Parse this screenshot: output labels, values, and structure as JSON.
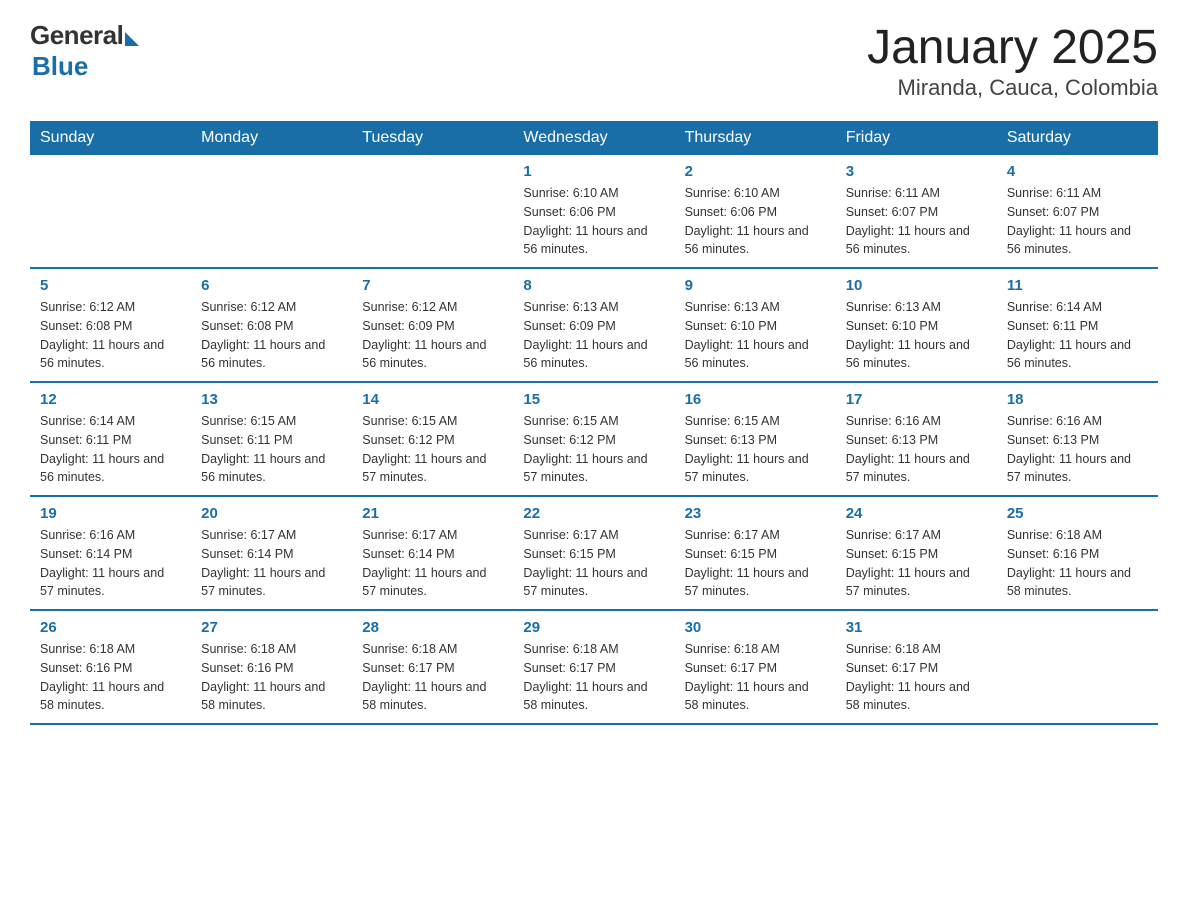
{
  "logo": {
    "general": "General",
    "blue": "Blue"
  },
  "title": "January 2025",
  "subtitle": "Miranda, Cauca, Colombia",
  "weekdays": [
    "Sunday",
    "Monday",
    "Tuesday",
    "Wednesday",
    "Thursday",
    "Friday",
    "Saturday"
  ],
  "weeks": [
    [
      {
        "day": "",
        "info": ""
      },
      {
        "day": "",
        "info": ""
      },
      {
        "day": "",
        "info": ""
      },
      {
        "day": "1",
        "info": "Sunrise: 6:10 AM\nSunset: 6:06 PM\nDaylight: 11 hours and 56 minutes."
      },
      {
        "day": "2",
        "info": "Sunrise: 6:10 AM\nSunset: 6:06 PM\nDaylight: 11 hours and 56 minutes."
      },
      {
        "day": "3",
        "info": "Sunrise: 6:11 AM\nSunset: 6:07 PM\nDaylight: 11 hours and 56 minutes."
      },
      {
        "day": "4",
        "info": "Sunrise: 6:11 AM\nSunset: 6:07 PM\nDaylight: 11 hours and 56 minutes."
      }
    ],
    [
      {
        "day": "5",
        "info": "Sunrise: 6:12 AM\nSunset: 6:08 PM\nDaylight: 11 hours and 56 minutes."
      },
      {
        "day": "6",
        "info": "Sunrise: 6:12 AM\nSunset: 6:08 PM\nDaylight: 11 hours and 56 minutes."
      },
      {
        "day": "7",
        "info": "Sunrise: 6:12 AM\nSunset: 6:09 PM\nDaylight: 11 hours and 56 minutes."
      },
      {
        "day": "8",
        "info": "Sunrise: 6:13 AM\nSunset: 6:09 PM\nDaylight: 11 hours and 56 minutes."
      },
      {
        "day": "9",
        "info": "Sunrise: 6:13 AM\nSunset: 6:10 PM\nDaylight: 11 hours and 56 minutes."
      },
      {
        "day": "10",
        "info": "Sunrise: 6:13 AM\nSunset: 6:10 PM\nDaylight: 11 hours and 56 minutes."
      },
      {
        "day": "11",
        "info": "Sunrise: 6:14 AM\nSunset: 6:11 PM\nDaylight: 11 hours and 56 minutes."
      }
    ],
    [
      {
        "day": "12",
        "info": "Sunrise: 6:14 AM\nSunset: 6:11 PM\nDaylight: 11 hours and 56 minutes."
      },
      {
        "day": "13",
        "info": "Sunrise: 6:15 AM\nSunset: 6:11 PM\nDaylight: 11 hours and 56 minutes."
      },
      {
        "day": "14",
        "info": "Sunrise: 6:15 AM\nSunset: 6:12 PM\nDaylight: 11 hours and 57 minutes."
      },
      {
        "day": "15",
        "info": "Sunrise: 6:15 AM\nSunset: 6:12 PM\nDaylight: 11 hours and 57 minutes."
      },
      {
        "day": "16",
        "info": "Sunrise: 6:15 AM\nSunset: 6:13 PM\nDaylight: 11 hours and 57 minutes."
      },
      {
        "day": "17",
        "info": "Sunrise: 6:16 AM\nSunset: 6:13 PM\nDaylight: 11 hours and 57 minutes."
      },
      {
        "day": "18",
        "info": "Sunrise: 6:16 AM\nSunset: 6:13 PM\nDaylight: 11 hours and 57 minutes."
      }
    ],
    [
      {
        "day": "19",
        "info": "Sunrise: 6:16 AM\nSunset: 6:14 PM\nDaylight: 11 hours and 57 minutes."
      },
      {
        "day": "20",
        "info": "Sunrise: 6:17 AM\nSunset: 6:14 PM\nDaylight: 11 hours and 57 minutes."
      },
      {
        "day": "21",
        "info": "Sunrise: 6:17 AM\nSunset: 6:14 PM\nDaylight: 11 hours and 57 minutes."
      },
      {
        "day": "22",
        "info": "Sunrise: 6:17 AM\nSunset: 6:15 PM\nDaylight: 11 hours and 57 minutes."
      },
      {
        "day": "23",
        "info": "Sunrise: 6:17 AM\nSunset: 6:15 PM\nDaylight: 11 hours and 57 minutes."
      },
      {
        "day": "24",
        "info": "Sunrise: 6:17 AM\nSunset: 6:15 PM\nDaylight: 11 hours and 57 minutes."
      },
      {
        "day": "25",
        "info": "Sunrise: 6:18 AM\nSunset: 6:16 PM\nDaylight: 11 hours and 58 minutes."
      }
    ],
    [
      {
        "day": "26",
        "info": "Sunrise: 6:18 AM\nSunset: 6:16 PM\nDaylight: 11 hours and 58 minutes."
      },
      {
        "day": "27",
        "info": "Sunrise: 6:18 AM\nSunset: 6:16 PM\nDaylight: 11 hours and 58 minutes."
      },
      {
        "day": "28",
        "info": "Sunrise: 6:18 AM\nSunset: 6:17 PM\nDaylight: 11 hours and 58 minutes."
      },
      {
        "day": "29",
        "info": "Sunrise: 6:18 AM\nSunset: 6:17 PM\nDaylight: 11 hours and 58 minutes."
      },
      {
        "day": "30",
        "info": "Sunrise: 6:18 AM\nSunset: 6:17 PM\nDaylight: 11 hours and 58 minutes."
      },
      {
        "day": "31",
        "info": "Sunrise: 6:18 AM\nSunset: 6:17 PM\nDaylight: 11 hours and 58 minutes."
      },
      {
        "day": "",
        "info": ""
      }
    ]
  ]
}
